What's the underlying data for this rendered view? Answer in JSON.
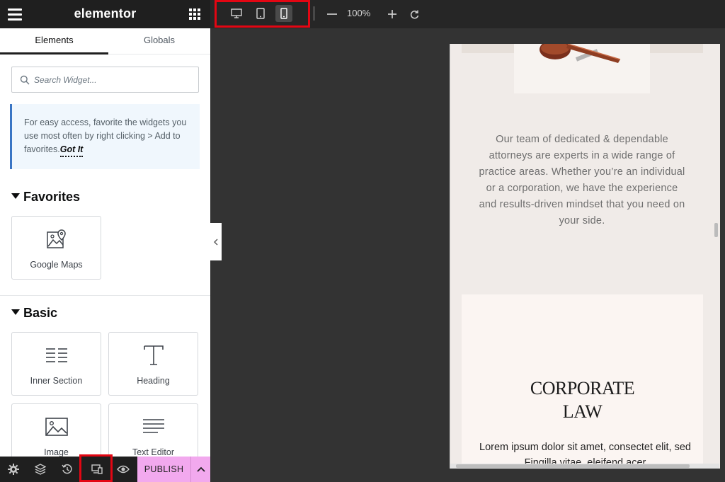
{
  "header": {
    "brand": "elementor"
  },
  "tabs": [
    {
      "label": "Elements"
    },
    {
      "label": "Globals"
    }
  ],
  "search": {
    "placeholder": "Search Widget..."
  },
  "notice": {
    "text": "For easy access, favorite the widgets you use most often by right clicking > Add to favorites.",
    "link": "Got It"
  },
  "sections": {
    "favorites": {
      "title": "Favorites",
      "widgets": [
        {
          "label": "Google Maps",
          "icon": "map-icon"
        }
      ]
    },
    "basic": {
      "title": "Basic",
      "widgets": [
        {
          "label": "Inner Section",
          "icon": "inner-section-icon"
        },
        {
          "label": "Heading",
          "icon": "heading-icon"
        },
        {
          "label": "Image",
          "icon": "image-icon"
        },
        {
          "label": "Text Editor",
          "icon": "text-editor-icon"
        }
      ]
    }
  },
  "footer": {
    "publish_label": "PUBLISH",
    "icons": [
      "settings-icon",
      "navigator-icon",
      "history-icon",
      "responsive-mode-icon",
      "preview-icon"
    ]
  },
  "topbar": {
    "devices": [
      "desktop-icon",
      "tablet-icon",
      "mobile-icon"
    ],
    "active_device": "mobile",
    "zoom": "100%"
  },
  "preview": {
    "paragraph": "Our team of dedicated & dependable attorneys are experts in a wide range of practice areas. Whether you’re an individual or a corporation, we have the experience and results-driven mindset that you need on your side.",
    "card_title_line1": "CORPORATE",
    "card_title_line2": "LAW",
    "card_body": "Lorem ipsum dolor sit amet, consectet elit, sed Fingilla vitae, eleifend acer"
  },
  "colors": {
    "highlight": "#e30613",
    "publish_bg": "#f2a9ee",
    "notice_border": "#3a75c4"
  }
}
